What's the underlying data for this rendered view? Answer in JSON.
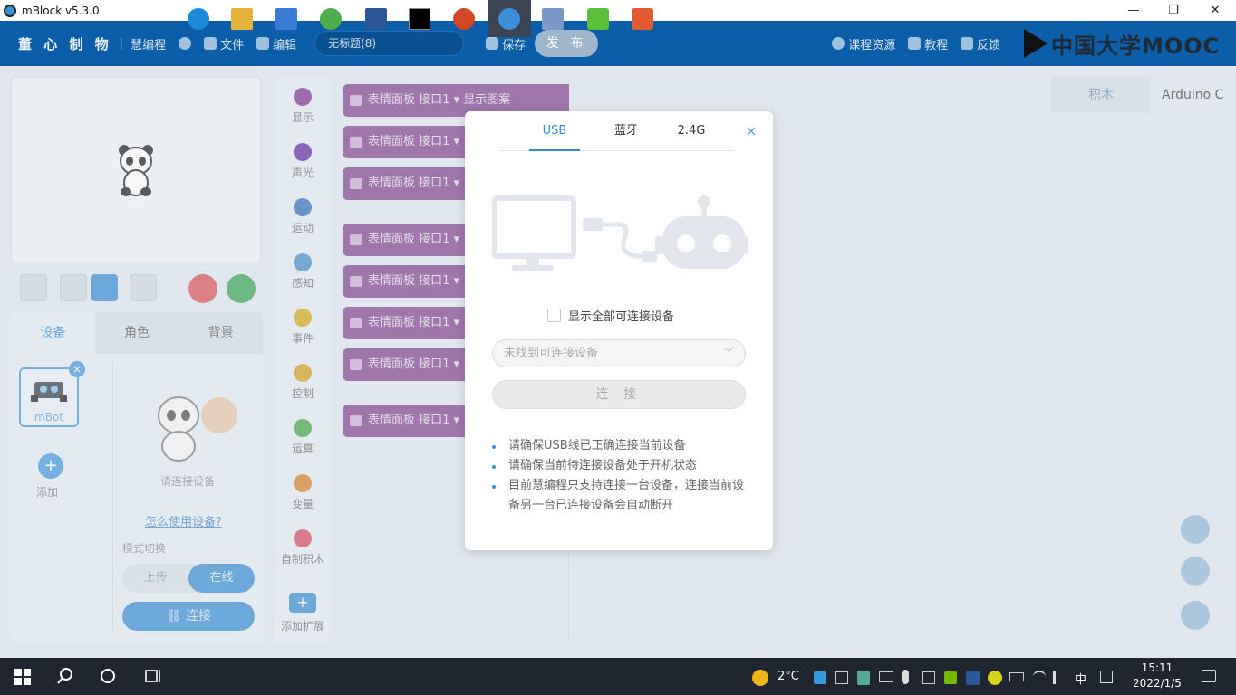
{
  "window": {
    "title": "mBlock v5.3.0",
    "minimize": "—",
    "restore": "❐",
    "close": "✕"
  },
  "menubar": {
    "brand": "董 心 制 物",
    "separator": "|",
    "product": "慧编程",
    "file": "文件",
    "edit": "编辑",
    "project_title": "无标题(8)",
    "save": "保存",
    "publish": "发 布",
    "course_resources": "课程资源",
    "tutorial": "教程",
    "feedback": "反馈"
  },
  "watermark": {
    "text": "中国大学MOOC"
  },
  "left": {
    "tabs": [
      "设备",
      "角色",
      "背景"
    ],
    "device_name": "mBot",
    "device_close": "×",
    "add_icon": "+",
    "add_label": "添加",
    "connect_hint": "请连接设备",
    "how_to_use": "怎么使用设备?",
    "mode_switch_label": "模式切换",
    "mode_upload": "上传",
    "mode_online": "在线",
    "connect_button": "连接"
  },
  "categories": [
    {
      "label": "显示",
      "color": "#7a2a8c"
    },
    {
      "label": "声光",
      "color": "#5a1fa0"
    },
    {
      "label": "运动",
      "color": "#2766b8"
    },
    {
      "label": "感知",
      "color": "#3a86c8"
    },
    {
      "label": "事件",
      "color": "#d8a20d"
    },
    {
      "label": "控制",
      "color": "#d89a12"
    },
    {
      "label": "运算",
      "color": "#3aa03a"
    },
    {
      "label": "变量",
      "color": "#d9781a"
    },
    {
      "label": "自制积木",
      "color": "#d8405a"
    }
  ],
  "add_extension": {
    "icon": "+",
    "label": "添加扩展"
  },
  "blocks": [
    {
      "label": "表情面板  接口1 ▾  显示图案"
    },
    {
      "label": "表情面板  接口1 ▾"
    },
    {
      "label": "表情面板  接口1 ▾"
    },
    {
      "label": "表情面板  接口1 ▾"
    },
    {
      "label": "表情面板  接口1 ▾"
    },
    {
      "label": "表情面板  接口1 ▾"
    },
    {
      "label": "表情面板  接口1 ▾"
    },
    {
      "label": "表情面板  接口1 ▾"
    }
  ],
  "right_tabs": {
    "blocks": "积木",
    "arduino": "Arduino C"
  },
  "modal": {
    "tabs": [
      "USB",
      "蓝牙",
      "2.4G"
    ],
    "active_tab": "USB",
    "close": "×",
    "show_all_label": "显示全部可连接设备",
    "select_placeholder": "未找到可连接设备",
    "connect_button": "连 接",
    "tips": [
      "请确保USB线已正确连接当前设备",
      "请确保当前待连接设备处于开机状态",
      "目前慧编程只支持连接一台设备，连接当前设备另一台已连接设备会自动断开"
    ]
  },
  "taskbar": {
    "weather": "2°C",
    "ime": "中",
    "time": "15:11",
    "date": "2022/1/5"
  }
}
